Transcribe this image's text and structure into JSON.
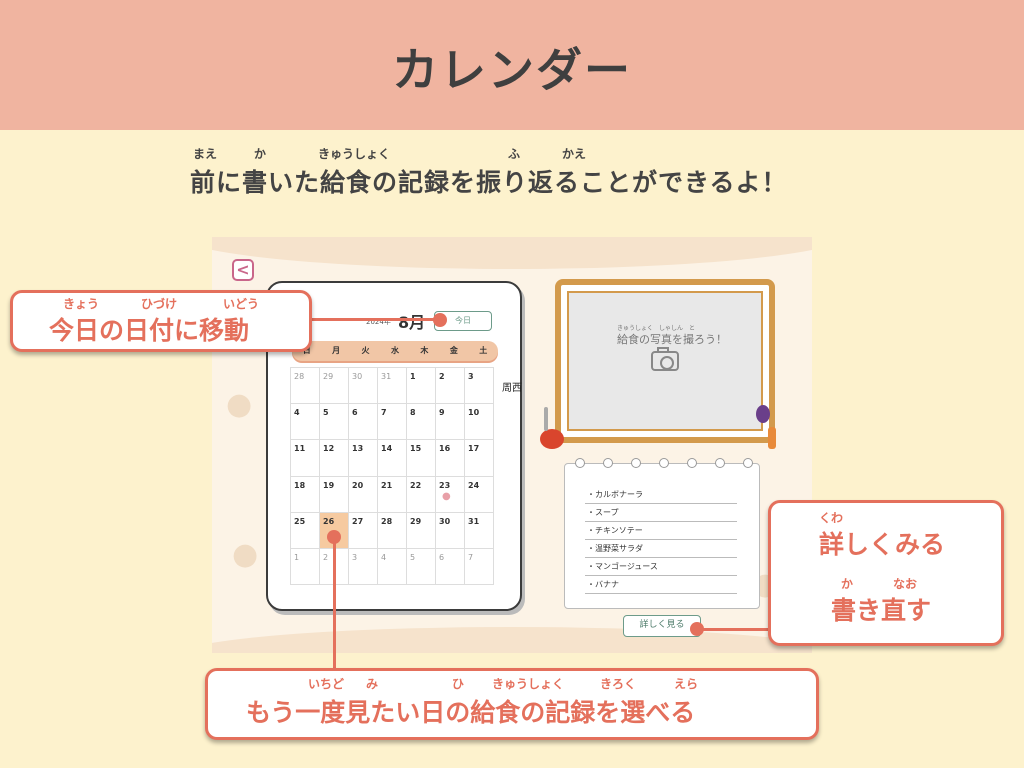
{
  "header": {
    "title": "カレンダー"
  },
  "subtitle": {
    "text": "前に書いた給食の記録を振り返ることができるよ！",
    "ruby": [
      "まえ",
      "か",
      "きゅうしょく",
      "ふ",
      "かえ"
    ]
  },
  "app": {
    "back_icon": "chevron-left-icon",
    "calendar": {
      "year": "2024年",
      "month": "8月",
      "today_button": "今日",
      "weekdays": [
        "日",
        "月",
        "火",
        "水",
        "木",
        "金",
        "土"
      ],
      "weeks": [
        [
          "28",
          "29",
          "30",
          "31",
          "1",
          "2",
          "3"
        ],
        [
          "4",
          "5",
          "6",
          "7",
          "8",
          "9",
          "10"
        ],
        [
          "11",
          "12",
          "13",
          "14",
          "15",
          "16",
          "17"
        ],
        [
          "18",
          "19",
          "20",
          "21",
          "22",
          "23",
          "24"
        ],
        [
          "25",
          "26",
          "27",
          "28",
          "29",
          "30",
          "31"
        ],
        [
          "1",
          "2",
          "3",
          "4",
          "5",
          "6",
          "7"
        ]
      ],
      "selected_day": "26",
      "stray_text": "周西"
    },
    "photo": {
      "ruby": "きゅうしょく　しゃしん　と",
      "placeholder": "給食の写真を撮ろう！",
      "icon": "camera-icon"
    },
    "menu": {
      "items": [
        "・カルボナーラ",
        "・スープ",
        "・チキンソテー",
        "・温野菜サラダ",
        "・マンゴージュース",
        "・バナナ"
      ]
    },
    "detail_button": "詳しく見る"
  },
  "callouts": {
    "today": {
      "text": "今日の日付に移動",
      "ruby": [
        "きょう",
        "ひづけ",
        "いどう"
      ]
    },
    "detail": {
      "line1": "詳しくみる",
      "ruby1": "くわ",
      "line2": "書き直す",
      "ruby2": [
        "か",
        "なお"
      ]
    },
    "select": {
      "text": "もう一度見たい日の給食の記録を選べる",
      "ruby": [
        "いちど",
        "み",
        "ひ",
        "きゅうしょく",
        "きろく",
        "えら"
      ]
    }
  },
  "colors": {
    "accent": "#e4705c",
    "header": "#f0b4a0",
    "background": "#fdf2cd",
    "button": "#6d9b8a"
  }
}
